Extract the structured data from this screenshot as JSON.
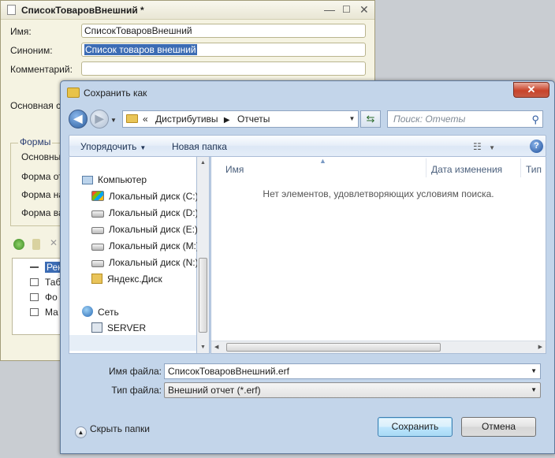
{
  "background_window": {
    "title": "СписокТоваровВнешний *",
    "name_label": "Имя:",
    "name_value": "СписокТоваровВнешний",
    "synonym_label": "Синоним:",
    "synonym_value": "Список товаров внешний",
    "comment_label": "Комментарий:",
    "main_form_label": "Основная сх",
    "forms_group_label": "Формы",
    "forms_items": [
      "Основны",
      "Форма от",
      "Форма на",
      "Форма ва"
    ],
    "tree_items": [
      "Рек",
      "Таб",
      "Фо",
      "Ма"
    ]
  },
  "dialog": {
    "title": "Сохранить как",
    "close_glyph": "✕",
    "address": {
      "overflow": "«",
      "segments": [
        "Дистрибутивы",
        "Отчеты"
      ],
      "separator": "▶"
    },
    "search_placeholder": "Поиск: Отчеты",
    "toolbar": {
      "organize_label": "Упорядочить",
      "new_folder_label": "Новая папка"
    },
    "nav_tree": {
      "computer_label": "Компьютер",
      "drives": [
        "Локальный диск (C:)",
        "Локальный диск (D:)",
        "Локальный диск (E:)",
        "Локальный диск (M:)",
        "Локальный диск (N:)"
      ],
      "yandex_label": "Яндекс.Диск",
      "network_label": "Сеть",
      "server_label": "SERVER"
    },
    "columns": [
      "Имя",
      "Дата изменения",
      "Тип"
    ],
    "empty_message": "Нет элементов, удовлетворяющих условиям поиска.",
    "filename_label": "Имя файла:",
    "filename_value": "СписокТоваровВнешний.erf",
    "filetype_label": "Тип файла:",
    "filetype_value": "Внешний отчет (*.erf)",
    "hide_folders_label": "Скрыть папки",
    "save_label": "Сохранить",
    "cancel_label": "Отмена"
  }
}
